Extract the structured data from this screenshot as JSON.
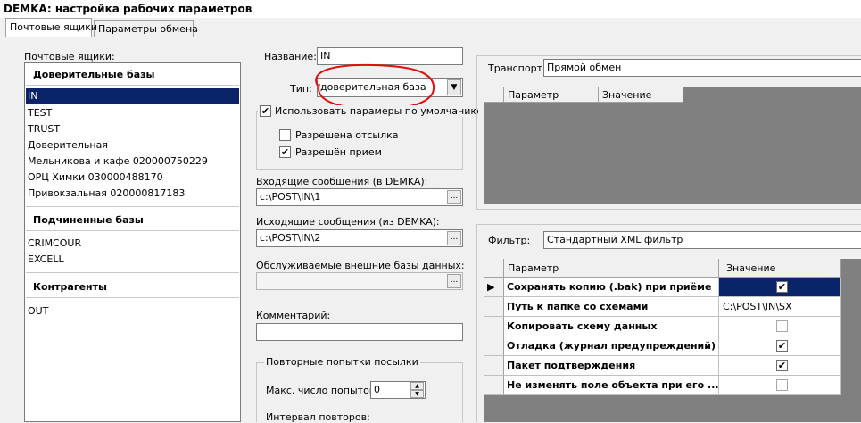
{
  "window": {
    "title": "DEMKA: настройка рабочих параметров"
  },
  "tabs": [
    {
      "label": "Почтовые ящики"
    },
    {
      "label": "Параметры обмена"
    }
  ],
  "mailboxes": {
    "label": "Почтовые ящики:",
    "groups": [
      {
        "title": "Доверительные базы",
        "items": [
          "IN",
          "TEST",
          "TRUST",
          "Доверительная",
          "Мельникова и кафе 020000750229",
          "ОРЦ Химки 030000488170",
          "Привокзальная 020000817183"
        ]
      },
      {
        "title": "Подчиненные базы",
        "items": [
          "CRIMCOUR",
          "EXCELL"
        ]
      },
      {
        "title": "Контрагенты",
        "items": [
          "OUT"
        ]
      }
    ],
    "selected": "IN"
  },
  "form": {
    "name_label": "Название:",
    "name_value": "IN",
    "type_label": "Тип:",
    "type_value": "доверительная база",
    "use_defaults_label": "Использовать парамеры по умолчанию",
    "use_defaults_checked": true,
    "allow_send_label": "Разрешена отсылка",
    "allow_send_checked": false,
    "allow_receive_label": "Разрешён прием",
    "allow_receive_checked": true,
    "incoming_label": "Входящие сообщения (в DEMKA):",
    "incoming_value": "c:\\POST\\IN\\1",
    "outgoing_label": "Исходящие сообщения (из DEMKA):",
    "outgoing_value": "c:\\POST\\IN\\2",
    "external_label": "Обслуживаемые внешние базы данных:",
    "external_value": "",
    "comment_label": "Комментарий:",
    "comment_value": "",
    "retries_group": "Повторные попытки посылки",
    "max_attempts_label": "Макс. число попыток:",
    "max_attempts_value": "0",
    "interval_label": "Интервал повторов:",
    "ellipsis": "..."
  },
  "transport": {
    "label": "Транспорт:",
    "value": "Прямой обмен",
    "columns": [
      "Параметр",
      "Значение"
    ]
  },
  "filter": {
    "label": "Фильтр:",
    "value": "Стандартный XML фильтр",
    "columns": [
      "Параметр",
      "Значение"
    ],
    "rows": [
      {
        "param": "Сохранять копию (.bak) при приёме",
        "kind": "check",
        "checked": true,
        "current": true
      },
      {
        "param": "Путь к папке со схемами",
        "kind": "text",
        "value": "C:\\POST\\IN\\SX"
      },
      {
        "param": "Копировать схему данных",
        "kind": "check",
        "checked": false
      },
      {
        "param": "Отладка (журнал предупреждений)",
        "kind": "check",
        "checked": true
      },
      {
        "param": "Пакет подтверждения",
        "kind": "check",
        "checked": true
      },
      {
        "param": "Не изменять поле объекта при его ...",
        "kind": "check",
        "checked": false
      }
    ]
  },
  "annotation": {
    "color": "#e01010"
  }
}
